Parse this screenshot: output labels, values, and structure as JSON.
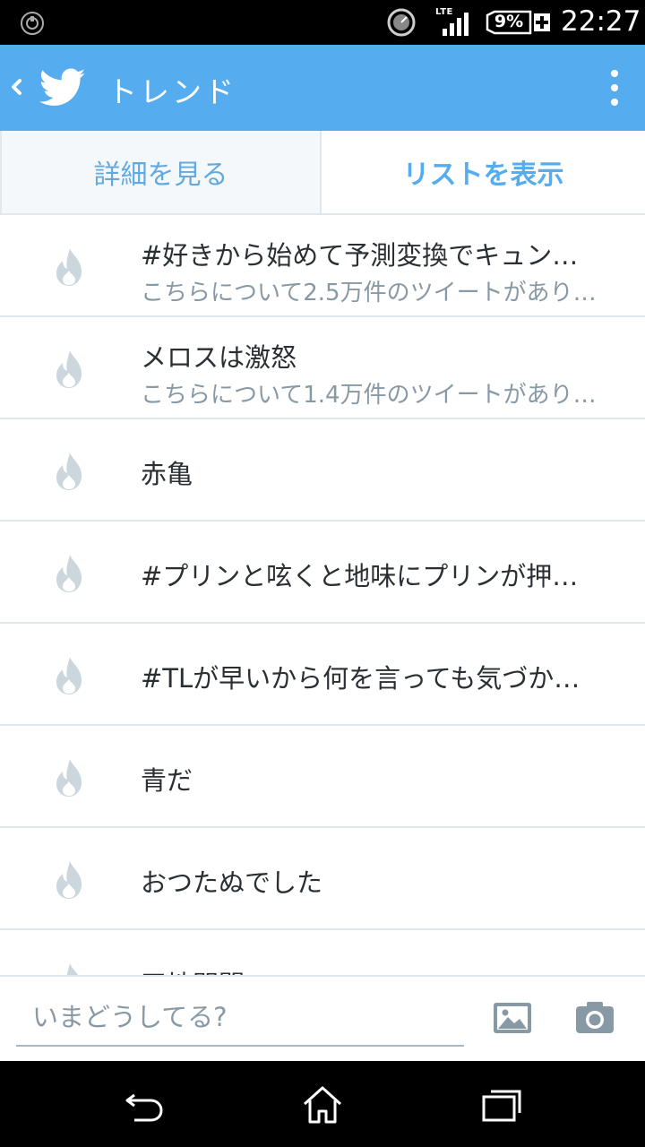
{
  "status_bar": {
    "network": "LTE",
    "battery": "9%",
    "time": "22:27"
  },
  "action_bar": {
    "title": "トレンド",
    "icons": [
      "back-chevron-icon",
      "twitter-bird-icon",
      "overflow-menu-icon"
    ]
  },
  "tabs": [
    {
      "label": "詳細を見る",
      "selected": false
    },
    {
      "label": "リストを表示",
      "selected": true
    }
  ],
  "trends": [
    {
      "title": "#好きから始めて予測変換でキュン…",
      "subtitle": "こちらについて2.5万件のツイートがあり…"
    },
    {
      "title": "メロスは激怒",
      "subtitle": "こちらについて1.4万件のツイートがあり…"
    },
    {
      "title": "赤亀",
      "subtitle": ""
    },
    {
      "title": "#プリンと呟くと地味にプリンが押…",
      "subtitle": ""
    },
    {
      "title": "#TLが早いから何を言っても気づか…",
      "subtitle": ""
    },
    {
      "title": "青だ",
      "subtitle": ""
    },
    {
      "title": "おつたぬでした",
      "subtitle": ""
    },
    {
      "title": "天地開闢",
      "subtitle": ""
    }
  ],
  "compose": {
    "placeholder": "いまどうしてる?",
    "icons": [
      "photo-icon",
      "camera-icon"
    ]
  },
  "colors": {
    "accent": "#55acee",
    "fire_icon": "#ccd6dd",
    "divider": "#e1e8ed",
    "subtitle": "#8899a6"
  }
}
